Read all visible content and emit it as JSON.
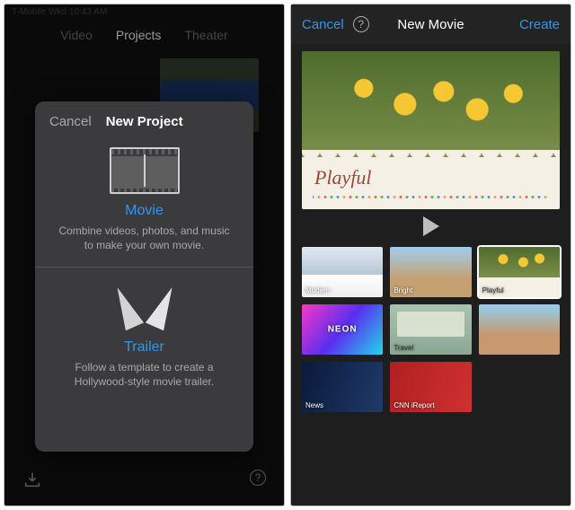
{
  "left": {
    "status_text": "T-Mobile Wkd   10:43 AM",
    "tabs": {
      "video": "Video",
      "projects": "Projects",
      "theater": "Theater"
    },
    "modal": {
      "cancel": "Cancel",
      "title": "New Project",
      "movie_title": "Movie",
      "movie_desc": "Combine videos, photos, and music to make your own movie.",
      "trailer_title": "Trailer",
      "trailer_desc": "Follow a template to create a Hollywood-style movie trailer."
    }
  },
  "right": {
    "cancel": "Cancel",
    "help_glyph": "?",
    "title": "New Movie",
    "create": "Create",
    "preview_label": "Playful",
    "themes": [
      {
        "label": "Modern"
      },
      {
        "label": "Bright"
      },
      {
        "label": "Playful"
      },
      {
        "label": "NEON"
      },
      {
        "label": "Travel"
      },
      {
        "label": ""
      },
      {
        "label": "News"
      },
      {
        "label": "CNN iReport"
      }
    ]
  }
}
